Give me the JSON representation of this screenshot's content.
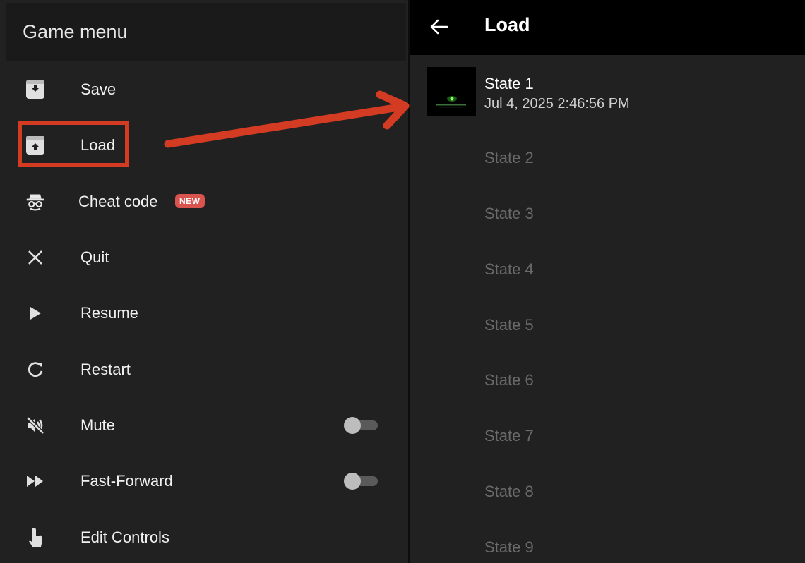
{
  "left_panel": {
    "title": "Game menu",
    "items": [
      {
        "label": "Save",
        "icon": "save-icon"
      },
      {
        "label": "Load",
        "icon": "load-icon"
      },
      {
        "label": "Cheat code",
        "icon": "spy-icon",
        "badge": "NEW"
      },
      {
        "label": "Quit",
        "icon": "close-icon"
      },
      {
        "label": "Resume",
        "icon": "play-icon"
      },
      {
        "label": "Restart",
        "icon": "refresh-icon"
      },
      {
        "label": "Mute",
        "icon": "muted-speaker-icon",
        "toggle": false
      },
      {
        "label": "Fast-Forward",
        "icon": "fast-forward-icon",
        "toggle": false
      },
      {
        "label": "Edit Controls",
        "icon": "touch-icon"
      }
    ]
  },
  "right_panel": {
    "title": "Load",
    "states": [
      {
        "label": "State 1",
        "timestamp": "Jul 4, 2025 2:46:56 PM",
        "has_save": true
      },
      {
        "label": "State 2",
        "has_save": false
      },
      {
        "label": "State 3",
        "has_save": false
      },
      {
        "label": "State 4",
        "has_save": false
      },
      {
        "label": "State 5",
        "has_save": false
      },
      {
        "label": "State 6",
        "has_save": false
      },
      {
        "label": "State 7",
        "has_save": false
      },
      {
        "label": "State 8",
        "has_save": false
      },
      {
        "label": "State 9",
        "has_save": false
      }
    ]
  },
  "annotation": {
    "highlight_color": "#d43b23"
  }
}
